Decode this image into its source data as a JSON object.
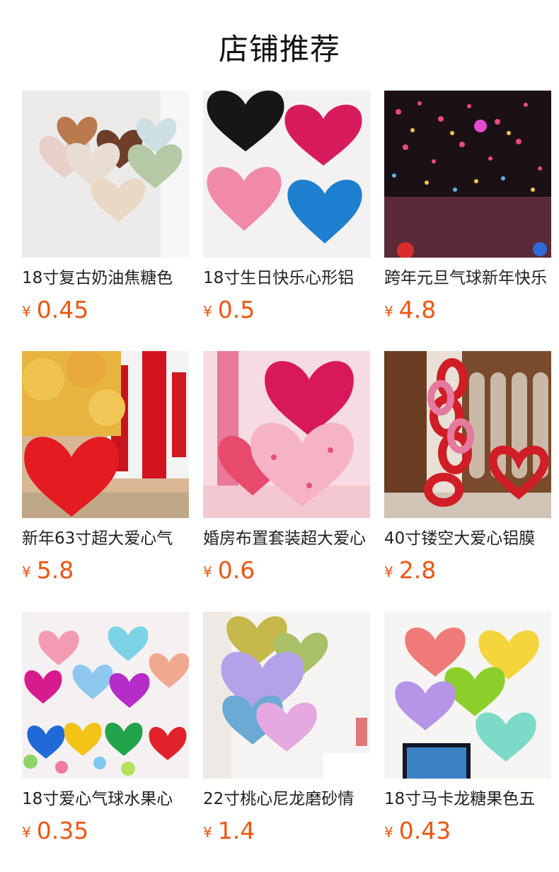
{
  "section": {
    "title": "店铺推荐"
  },
  "products": [
    {
      "name": "18寸复古奶油焦糖色",
      "currency": "¥",
      "price": "0.45",
      "image_icon": "caramel-heart-balloons-image"
    },
    {
      "name": "18寸生日快乐心形铝",
      "currency": "¥",
      "price": "0.5",
      "image_icon": "birthday-heart-balloons-image"
    },
    {
      "name": "跨年元旦气球新年快乐",
      "currency": "¥",
      "price": "4.8",
      "image_icon": "new-year-balloon-release-image"
    },
    {
      "name": "新年63寸超大爱心气",
      "currency": "¥",
      "price": "5.8",
      "image_icon": "giant-red-heart-balloon-image"
    },
    {
      "name": "婚房布置套装超大爱心",
      "currency": "¥",
      "price": "0.6",
      "image_icon": "love-heart-wedding-set-image"
    },
    {
      "name": "40寸镂空大爱心铝膜",
      "currency": "¥",
      "price": "2.8",
      "image_icon": "hollow-heart-chain-balloon-image"
    },
    {
      "name": "18寸爱心气球水果心",
      "currency": "¥",
      "price": "0.35",
      "image_icon": "fruit-color-heart-balloons-image"
    },
    {
      "name": "22寸桃心尼龙磨砂情",
      "currency": "¥",
      "price": "1.4",
      "image_icon": "matte-peach-heart-balloons-image"
    },
    {
      "name": "18寸马卡龙糖果色五",
      "currency": "¥",
      "price": "0.43",
      "image_icon": "macaron-heart-balloons-image"
    }
  ],
  "colors": {
    "price": "#ee5511",
    "title": "#111111",
    "name": "#222222"
  }
}
